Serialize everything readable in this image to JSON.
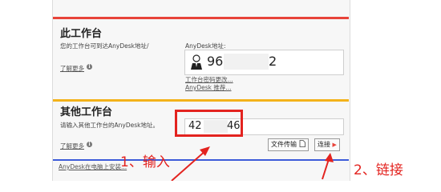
{
  "this_workstation": {
    "title": "此工作台",
    "desc": "您的工作台可到达AnyDesk地址/",
    "learn_more": "了解更多",
    "address_label": "AnyDesk地址:",
    "address_prefix": "96",
    "address_suffix": "2",
    "password_link": "工作台密码更改...",
    "recommend_link": "AnyDesk 推荐..."
  },
  "other_workstation": {
    "title": "其他工作台",
    "desc": "请输入其他工作台的AnyDesk地址。",
    "learn_more": "了解更多",
    "remote_prefix": "42",
    "remote_suffix": "46",
    "file_transfer_label": "文件传输",
    "connect_label": "连接"
  },
  "install_link": "AnyDesk在电脑上安装...",
  "annotations": {
    "step1": "1、输入",
    "step2": "2、链接"
  },
  "colors": {
    "accent_red": "#e3231f",
    "stripe_red": "#e8433a",
    "stripe_yellow": "#f3b21a",
    "stripe_blue": "#3d5bd9"
  }
}
